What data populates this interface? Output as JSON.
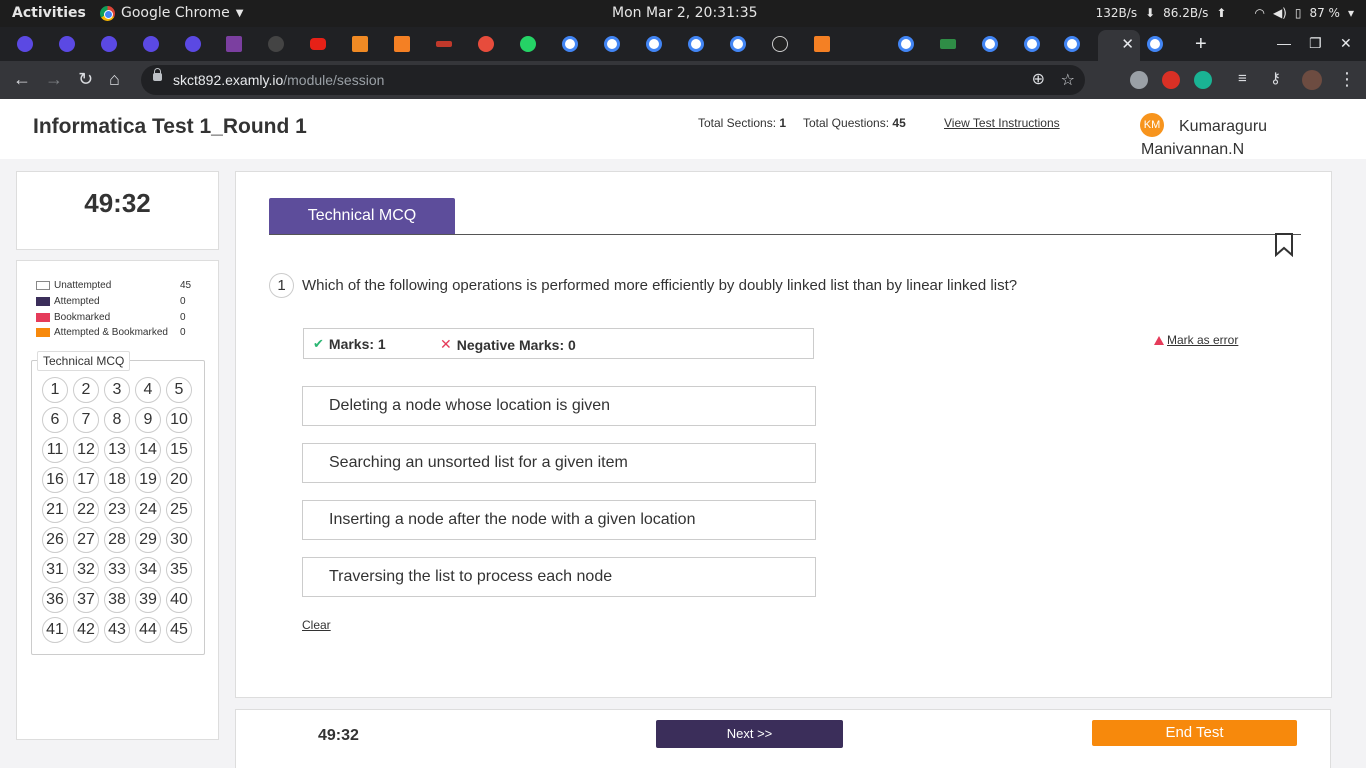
{
  "os": {
    "activities": "Activities",
    "app_name": "Google Chrome",
    "clock": "Mon Mar  2, 20:31:35",
    "net_down": "132B/s",
    "net_up": "86.2B/s",
    "battery": "87 %"
  },
  "browser": {
    "url_host": "skct892.examly.io",
    "url_path": "/module/session"
  },
  "header": {
    "title": "Informatica Test 1_Round 1",
    "total_sections_label": "Total Sections:",
    "total_sections_value": "1",
    "total_questions_label": "Total Questions:",
    "total_questions_value": "45",
    "view_instructions": "View Test Instructions",
    "user_initials": "KM",
    "user_name": "Kumaraguru Manivannan.N"
  },
  "timer": {
    "value": "49:32"
  },
  "legend": {
    "items": [
      {
        "label": "Unattempted",
        "count": "45",
        "color": "#ffffff"
      },
      {
        "label": "Attempted",
        "count": "0",
        "color": "#3b2e5a"
      },
      {
        "label": "Bookmarked",
        "count": "0",
        "color": "#e53b5a"
      },
      {
        "label": "Attempted & Bookmarked",
        "count": "0",
        "color": "#f7890c"
      }
    ],
    "section_title": "Technical MCQ",
    "questions": [
      "1",
      "2",
      "3",
      "4",
      "5",
      "6",
      "7",
      "8",
      "9",
      "10",
      "11",
      "12",
      "13",
      "14",
      "15",
      "16",
      "17",
      "18",
      "19",
      "20",
      "21",
      "22",
      "23",
      "24",
      "25",
      "26",
      "27",
      "28",
      "29",
      "30",
      "31",
      "32",
      "33",
      "34",
      "35",
      "36",
      "37",
      "38",
      "39",
      "40",
      "41",
      "42",
      "43",
      "44",
      "45"
    ]
  },
  "question": {
    "section_tab": "Technical MCQ",
    "number": "1",
    "text": "Which of the following operations is performed more efficiently by doubly linked list than by linear linked list?",
    "marks_label": "Marks: 1",
    "negative_marks_label": "Negative Marks: 0",
    "mark_error": "Mark as error",
    "options": [
      "Deleting a node whose location is given",
      "Searching an unsorted list for a given item",
      "Inserting a node after the node with a given location",
      "Traversing the list to process each node"
    ],
    "clear": "Clear"
  },
  "footer": {
    "timer": "49:32",
    "next": "Next >>",
    "end": "End Test"
  },
  "colors": {
    "accent": "#5d4d9b",
    "next_button": "#3b2e5a",
    "end_button": "#f7890c"
  }
}
